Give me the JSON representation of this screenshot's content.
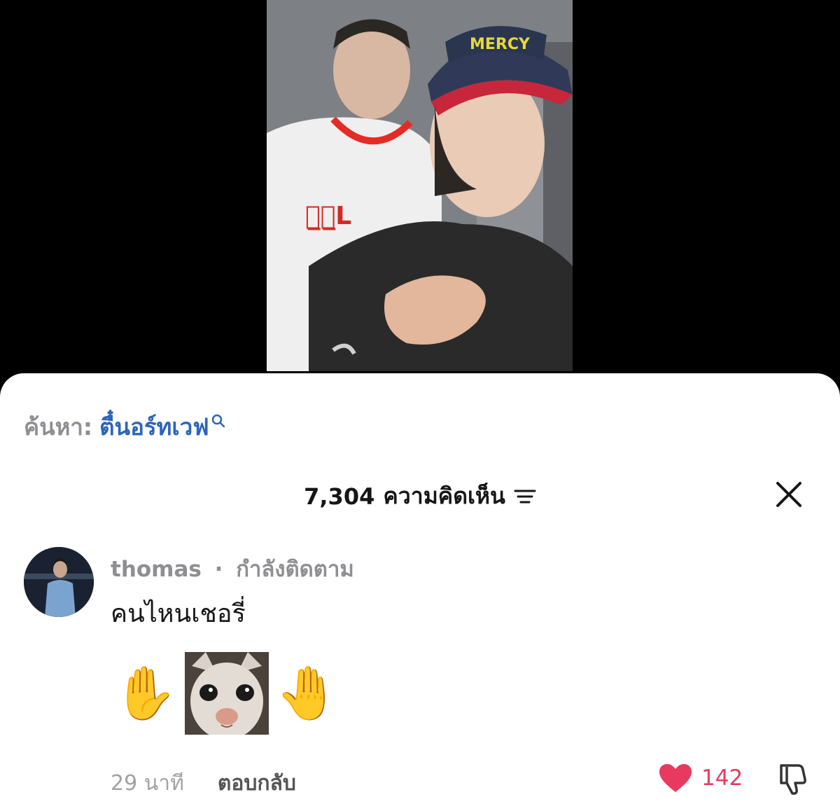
{
  "search": {
    "prefix": "ค้นหา:",
    "term": "ตื๋นอร์ทเวฟ"
  },
  "comments_header": {
    "count": "7,304",
    "label": "ความคิดเห็น"
  },
  "comment": {
    "username": "thomas",
    "separator": "·",
    "status": "กำลังติดตาม",
    "text": "คนไหนเชอรี่",
    "emojis": [
      "✋",
      "🤚"
    ],
    "time": "29 นาที",
    "reply_label": "ตอบกลับ",
    "like_count": "142"
  },
  "icons": {
    "search": "search-icon",
    "sort": "sort-icon",
    "close": "close-icon",
    "heart": "heart-icon",
    "dislike": "thumbs-down-icon"
  },
  "colors": {
    "search_term": "#2d64b8",
    "like": "#e83a5e",
    "muted": "#8e8e93"
  }
}
